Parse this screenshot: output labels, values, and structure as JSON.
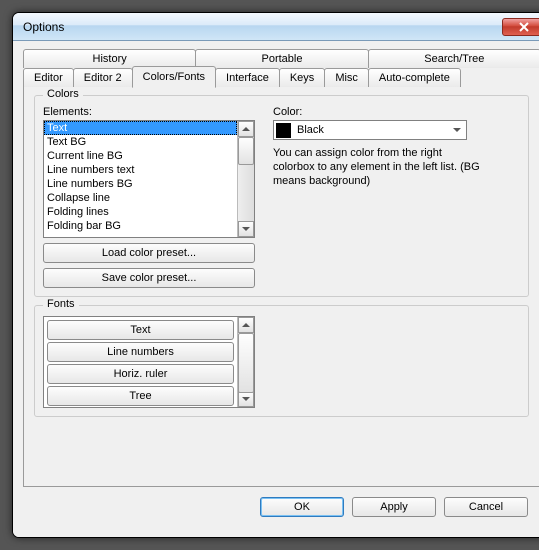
{
  "window": {
    "title": "Options"
  },
  "topTabs": {
    "t0": "History",
    "t1": "Portable",
    "t2": "Search/Tree"
  },
  "tabs": {
    "t0": "Editor",
    "t1": "Editor 2",
    "t2": "Colors/Fonts",
    "t3": "Interface",
    "t4": "Keys",
    "t5": "Misc",
    "t6": "Auto-complete"
  },
  "colors": {
    "group_label": "Colors",
    "elements_label": "Elements:",
    "color_label": "Color:",
    "items": {
      "i0": "Text",
      "i1": "Text BG",
      "i2": "Current line BG",
      "i3": "Line numbers text",
      "i4": "Line numbers BG",
      "i5": "Collapse line",
      "i6": "Folding lines",
      "i7": "Folding bar BG"
    },
    "selected_color": "Black",
    "hint": "You can assign color from the right colorbox to any element in the left list. (BG means background)",
    "load_preset": "Load color preset...",
    "save_preset": "Save color preset..."
  },
  "fonts": {
    "group_label": "Fonts",
    "items": {
      "f0": "Text",
      "f1": "Line numbers",
      "f2": "Horiz. ruler",
      "f3": "Tree"
    }
  },
  "buttons": {
    "ok": "OK",
    "apply": "Apply",
    "cancel": "Cancel"
  }
}
